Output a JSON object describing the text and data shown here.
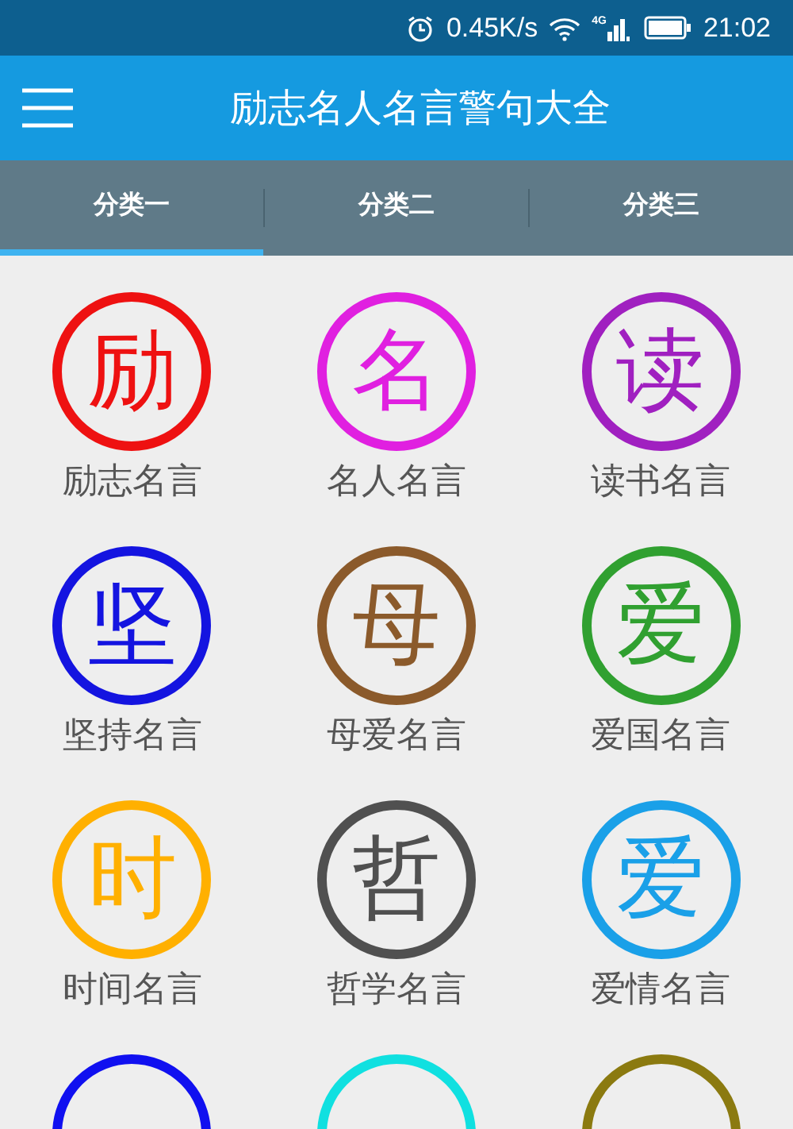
{
  "status_bar": {
    "speed": "0.45K/s",
    "network": "4G",
    "time": "21:02"
  },
  "app_bar": {
    "title": "励志名人名言警句大全"
  },
  "tabs": [
    {
      "label": "分类一",
      "selected": true
    },
    {
      "label": "分类二",
      "selected": false
    },
    {
      "label": "分类三",
      "selected": false
    }
  ],
  "categories": [
    {
      "glyph": "励",
      "label": "励志名言",
      "color": "#ee1111"
    },
    {
      "glyph": "名",
      "label": "名人名言",
      "color": "#e020e0"
    },
    {
      "glyph": "读",
      "label": "读书名言",
      "color": "#a020c0"
    },
    {
      "glyph": "坚",
      "label": "坚持名言",
      "color": "#1414e0"
    },
    {
      "glyph": "母",
      "label": "母爱名言",
      "color": "#8b5a2b"
    },
    {
      "glyph": "爱",
      "label": "爱国名言",
      "color": "#30a030"
    },
    {
      "glyph": "时",
      "label": "时间名言",
      "color": "#ffb000"
    },
    {
      "glyph": "哲",
      "label": "哲学名言",
      "color": "#505050"
    },
    {
      "glyph": "爱",
      "label": "爱情名言",
      "color": "#1aa0e8"
    },
    {
      "color": "#1010f0"
    },
    {
      "color": "#10e0e0"
    },
    {
      "color": "#8b7a10"
    }
  ]
}
